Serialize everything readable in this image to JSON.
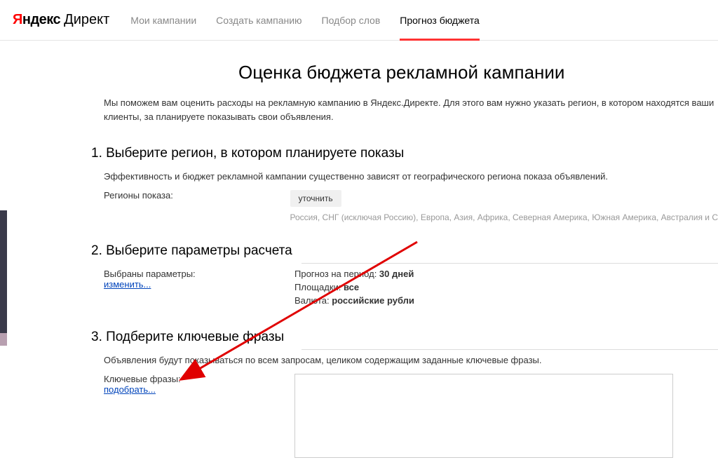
{
  "header": {
    "logo_ya": "Я",
    "logo_ndex": "ндекс",
    "logo_direct": "Директ",
    "nav": [
      {
        "label": "Мои кампании",
        "active": false
      },
      {
        "label": "Создать кампанию",
        "active": false
      },
      {
        "label": "Подбор слов",
        "active": false
      },
      {
        "label": "Прогноз бюджета",
        "active": true
      }
    ]
  },
  "page": {
    "title": "Оценка бюджета рекламной кампании",
    "intro": "Мы поможем вам оценить расходы на рекламную кампанию в Яндекс.Директе. Для этого вам нужно указать регион, в котором находятся ваши клиенты, за планируете показывать свои объявления."
  },
  "section1": {
    "title": "1. Выберите регион, в котором планируете показы",
    "desc": "Эффективность и бюджет рекламной кампании существенно зависят от географического региона показа объявлений.",
    "label": "Регионы показа:",
    "button": "уточнить",
    "regions": "Россия, СНГ (исключая Россию), Европа, Азия, Африка, Северная Америка, Южная Америка, Австралия и С"
  },
  "section2": {
    "title": "2. Выберите параметры расчета",
    "label": "Выбраны параметры:",
    "link": "изменить...",
    "period_label": "Прогноз на период: ",
    "period_value": "30 дней",
    "platforms_label": "Площадки: ",
    "platforms_value": "все",
    "currency_label": "Валюта: ",
    "currency_value": "российские рубли"
  },
  "section3": {
    "title": "3. Подберите ключевые фразы",
    "desc": "Объявления будут показываться по всем запросам, целиком содержащим заданные ключевые фразы.",
    "label": "Ключевые фразы:",
    "link": "подобрать..."
  }
}
